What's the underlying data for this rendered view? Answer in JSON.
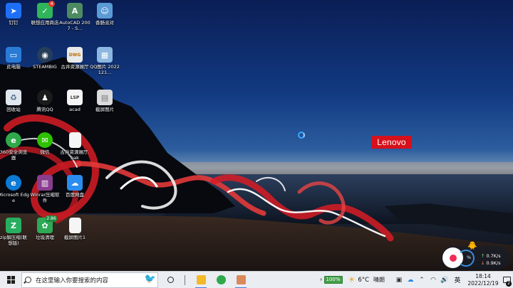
{
  "desktop": {
    "brand_logo": "Lenovo",
    "icons": [
      {
        "label": "钉钉",
        "icon": "dingtalk-icon",
        "color": "#1e6ff5",
        "glyph": "➤",
        "badge": ""
      },
      {
        "label": "联想应用商店",
        "icon": "lenovo-app-store-icon",
        "color": "#2fb55a",
        "glyph": "✓",
        "badge": "4"
      },
      {
        "label": "AutoCAD 2007 - S...",
        "icon": "autocad-icon",
        "color": "#4d8a62",
        "glyph": "A",
        "badge": ""
      },
      {
        "label": "香肠派对",
        "icon": "sausage-party-icon",
        "color": "#5b9bd5",
        "glyph": "☺",
        "badge": ""
      },
      {
        "label": "此电脑",
        "icon": "this-pc-icon",
        "color": "#2a7bd6",
        "glyph": "▭",
        "badge": ""
      },
      {
        "label": "STEAMBIG",
        "icon": "steam-icon",
        "color": "#263e59",
        "glyph": "◉",
        "badge": ""
      },
      {
        "label": "古井资源展厅",
        "icon": "dwg-file-icon",
        "color": "#e9e9e9",
        "glyph": "DWG",
        "badge": ""
      },
      {
        "label": "QQ图片 2022121...",
        "icon": "image-file-icon",
        "color": "#8bb7e0",
        "glyph": "▦",
        "badge": ""
      },
      {
        "label": "回收站",
        "icon": "recycle-bin-icon",
        "color": "#dfe6ee",
        "glyph": "♻",
        "badge": ""
      },
      {
        "label": "腾讯QQ",
        "icon": "qq-penguin-icon",
        "color": "#1b1b1b",
        "glyph": "♟",
        "badge": ""
      },
      {
        "label": "acad",
        "icon": "lisp-file-icon",
        "color": "#f5f5f5",
        "glyph": "LSP",
        "badge": ""
      },
      {
        "label": "截屏图片",
        "icon": "screenshot-image-icon",
        "color": "#dcdcdc",
        "glyph": "▤",
        "badge": ""
      },
      {
        "label": "360安全浏览器",
        "icon": "360-browser-icon",
        "color": "#2fa94a",
        "glyph": "e",
        "badge": ""
      },
      {
        "label": "微信",
        "icon": "wechat-icon",
        "color": "#2dc100",
        "glyph": "✉",
        "badge": ""
      },
      {
        "label": "古井资源展厅.bak",
        "icon": "bak-file-icon",
        "color": "#f5f5f5",
        "glyph": "",
        "badge": ""
      },
      {
        "label": "Microsoft Edge",
        "icon": "edge-browser-icon",
        "color": "#0c7bd6",
        "glyph": "e",
        "badge": ""
      },
      {
        "label": "Winrar压缩软件",
        "icon": "winrar-icon",
        "color": "#8a3c8f",
        "glyph": "▥",
        "badge": ""
      },
      {
        "label": "百度网盘",
        "icon": "baidu-netdisk-icon",
        "color": "#2b8df0",
        "glyph": "☁",
        "badge": ""
      },
      {
        "label": "zip解压缩(联想版)",
        "icon": "zip-extract-icon",
        "color": "#27ae60",
        "glyph": "Z",
        "badge": ""
      },
      {
        "label": "垃圾清理",
        "icon": "junk-cleaner-icon",
        "color": "#2eaa56",
        "glyph": "✿",
        "badge": "2.86"
      },
      {
        "label": "截屏图片1",
        "icon": "blank-file-icon",
        "color": "#f5f5f5",
        "glyph": "",
        "badge": ""
      }
    ]
  },
  "widget": {
    "percent_symbol": "%",
    "upload": "0.7K/s",
    "download": "0.9K/s",
    "record_color": "#ef2d56"
  },
  "taskbar": {
    "search_placeholder": "在这里输入你要搜索的内容",
    "pinned_apps": [
      {
        "name": "file-explorer-icon",
        "color": "#f3b928",
        "active": true
      },
      {
        "name": "360-browser-taskbar-icon",
        "color": "#2fa94a",
        "active": false
      },
      {
        "name": "tea-app-taskbar-icon",
        "color": "#d98a5b",
        "active": true
      }
    ],
    "battery": "100%",
    "weather_temp": "6°C",
    "weather_text": "晴朗",
    "ime": "英",
    "time": "18:14",
    "date": "2022/12/19",
    "notification_count": "2"
  }
}
